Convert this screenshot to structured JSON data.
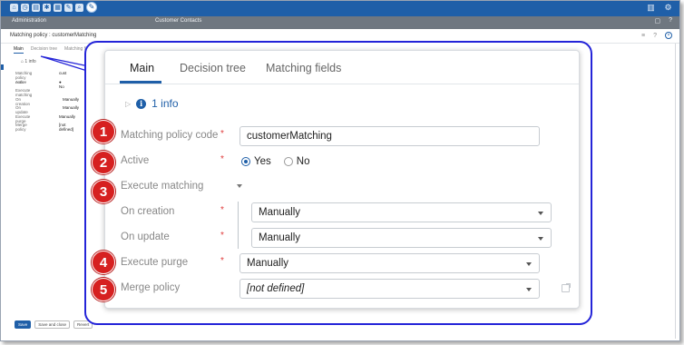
{
  "app": {
    "section": "Administration",
    "module": "Customer Contacts",
    "page_title": "Matching policy : customerMatching"
  },
  "topbar": {
    "icons": [
      "home-icon",
      "clock-icon",
      "document-icon",
      "gear-icon",
      "database-icon",
      "wrench-icon",
      "search-icon",
      "pen-icon"
    ],
    "right_icons": [
      "columns-icon",
      "settings-icon"
    ]
  },
  "background_form": {
    "tabs": [
      "Main",
      "Decision tree",
      "Matching fi"
    ],
    "info": "1 info",
    "rows": [
      {
        "label": "Matching policy code",
        "value": "cust"
      },
      {
        "label": "Active",
        "value": "● No"
      },
      {
        "label": "Execute matching",
        "value": ""
      },
      {
        "label": "On creation",
        "value": "Manually"
      },
      {
        "label": "On update",
        "value": "Manually"
      },
      {
        "label": "Execute purge",
        "value": "Manually"
      },
      {
        "label": "Merge policy",
        "value": "[not defined]"
      }
    ],
    "buttons": [
      "Save",
      "Save and close",
      "Revert"
    ]
  },
  "tabs": [
    {
      "label": "Main",
      "active": true
    },
    {
      "label": "Decision tree",
      "active": false
    },
    {
      "label": "Matching fields",
      "active": false
    }
  ],
  "info": {
    "label": "1 info"
  },
  "form": {
    "matching_policy_code": {
      "label": "Matching policy code",
      "required": "*",
      "value": "customerMatching",
      "badge": "1"
    },
    "active": {
      "label": "Active",
      "required": "*",
      "options": [
        "Yes",
        "No"
      ],
      "selected": "Yes",
      "badge": "2"
    },
    "execute_matching": {
      "label": "Execute matching",
      "badge": "3"
    },
    "on_creation": {
      "label": "On creation",
      "required": "*",
      "value": "Manually"
    },
    "on_update": {
      "label": "On update",
      "required": "*",
      "value": "Manually"
    },
    "execute_purge": {
      "label": "Execute purge",
      "required": "*",
      "value": "Manually",
      "badge": "4"
    },
    "merge_policy": {
      "label": "Merge policy",
      "value": "[not defined]",
      "badge": "5"
    }
  },
  "colors": {
    "accent": "#1f5fa8",
    "badge": "#d62020",
    "callout": "#2424d8",
    "required": "#e03c3c"
  }
}
